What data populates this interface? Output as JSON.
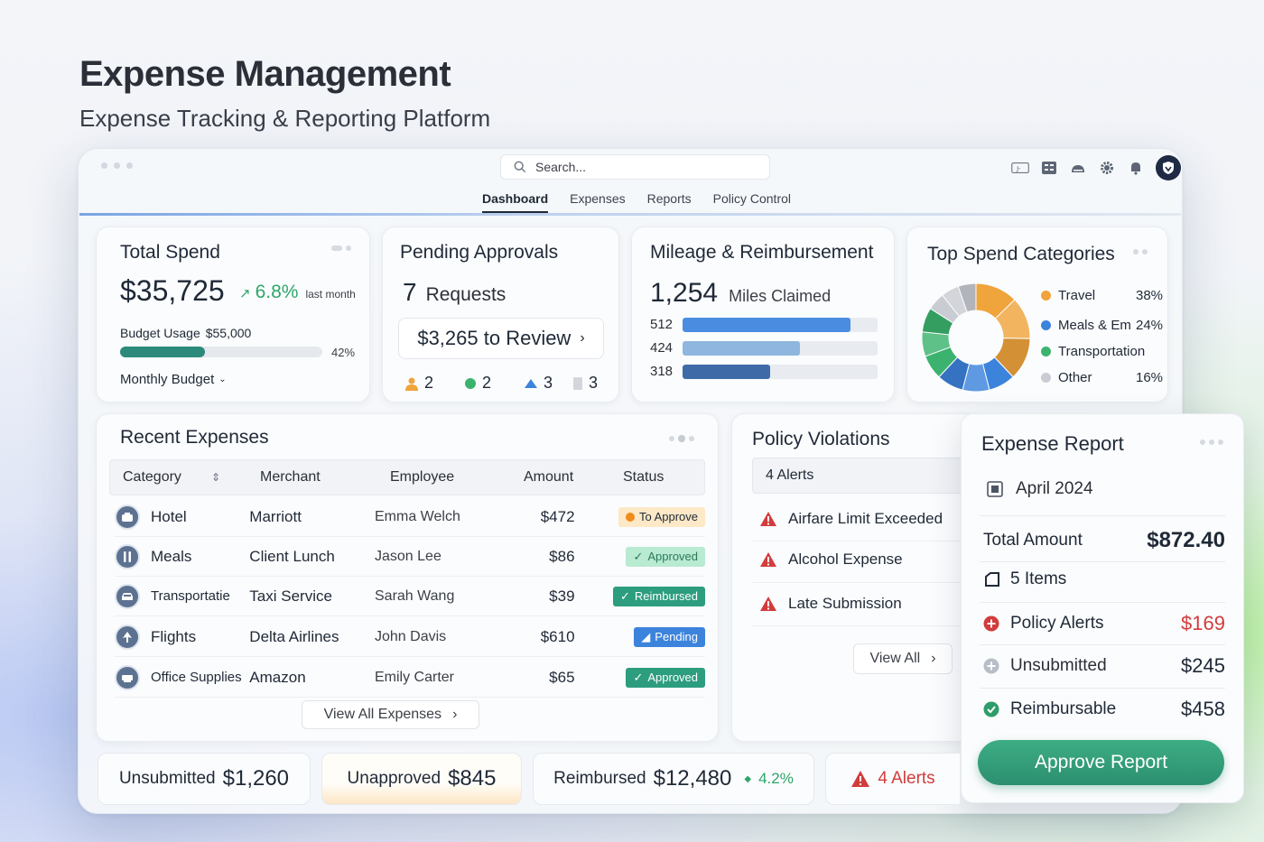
{
  "hero": {
    "title": "Expense Management",
    "subtitle": "Expense Tracking & Reporting Platform"
  },
  "search": {
    "placeholder": "Search..."
  },
  "nav": {
    "tabs": [
      "Dashboard",
      "Expenses",
      "Reports",
      "Policy Control"
    ],
    "active": "Dashboard"
  },
  "toolbar": {
    "icons": [
      "keyboard-icon",
      "grid-icon",
      "cloud-icon",
      "gear-icon",
      "bell-icon",
      "shield-avatar"
    ]
  },
  "total_spend": {
    "title": "Total Spend",
    "amount": "$35,725",
    "change": "6.8%",
    "change_note": "last month",
    "budget_label": "Budget Usage",
    "budget_value": "$55,000",
    "usage_percent_label": "42%",
    "usage_fraction": 0.42,
    "dropdown": "Monthly Budget"
  },
  "pending": {
    "title": "Pending Approvals",
    "count": "7",
    "count_label": "Requests",
    "review_button": "$3,265 to Review",
    "counters": [
      {
        "icon": "person-icon",
        "value": "2",
        "color": "#f0a43c"
      },
      {
        "icon": "circle-icon",
        "value": "2",
        "color": "#3bb36e"
      },
      {
        "icon": "triangle-icon",
        "value": "3",
        "color": "#3c83dc"
      },
      {
        "icon": "document-icon",
        "value": "3",
        "color": "#c9cdd3"
      }
    ]
  },
  "mileage": {
    "title": "Mileage & Reimbursement",
    "value": "1,254",
    "value_label": "Miles Claimed",
    "bars": [
      {
        "label": "512",
        "fraction": 0.86,
        "color": "#4a8de0"
      },
      {
        "label": "424",
        "fraction": 0.6,
        "color": "#8fb6de"
      },
      {
        "label": "318",
        "fraction": 0.45,
        "color": "#3f6aa8"
      }
    ]
  },
  "categories": {
    "title": "Top Spend Categories",
    "chart_data": {
      "type": "pie",
      "slices": [
        {
          "name": "Travel",
          "percent_label": "38%",
          "value": 38,
          "color": "#f0a43c"
        },
        {
          "name": "Meals & Em",
          "percent_label": "24%",
          "value": 24,
          "color": "#3c83dc"
        },
        {
          "name": "Transportation",
          "percent_label": "",
          "value": 22,
          "color": "#3bb36e"
        },
        {
          "name": "Other",
          "percent_label": "16%",
          "value": 16,
          "color": "#c9ccd3"
        }
      ]
    }
  },
  "recent": {
    "title": "Recent Expenses",
    "columns": [
      "Category",
      "Merchant",
      "Employee",
      "Amount",
      "Status"
    ],
    "rows": [
      {
        "category": "Hotel",
        "icon": "hotel-icon",
        "merchant": "Marriott",
        "employee": "Emma Welch",
        "amount": "$472",
        "status": "To Approve",
        "status_style": "orange"
      },
      {
        "category": "Meals",
        "icon": "utensils-icon",
        "merchant": "Client Lunch",
        "employee": "Jason Lee",
        "amount": "$86",
        "status": "Approved",
        "status_style": "lgreen"
      },
      {
        "category": "Transportatie",
        "icon": "car-icon",
        "merchant": "Taxi Service",
        "employee": "Sarah Wang",
        "amount": "$39",
        "status": "Reimbursed",
        "status_style": "teal"
      },
      {
        "category": "Flights",
        "icon": "plane-icon",
        "merchant": "Delta Airlines",
        "employee": "John Davis",
        "amount": "$610",
        "status": "Pending",
        "status_style": "blue"
      },
      {
        "category": "Office Supplies",
        "icon": "printer-icon",
        "merchant": "Amazon",
        "employee": "Emily Carter",
        "amount": "$65",
        "status": "Approved",
        "status_style": "teal"
      }
    ],
    "view_all": "View All Expenses"
  },
  "violations": {
    "title": "Policy Violations",
    "alerts": "4 Alerts",
    "items": [
      "Airfare Limit Exceeded",
      "Alcohol Expense",
      "Late Submission"
    ],
    "view_all": "View All"
  },
  "report": {
    "title": "Expense Report",
    "period": "April 2024",
    "total_label": "Total Amount",
    "total_value": "$872.40",
    "items_label": "5 Items",
    "policy_label": "Policy Alerts",
    "policy_value": "$169",
    "unsub_label": "Unsubmitted",
    "unsub_value": "$245",
    "reimb_label": "Reimbursable",
    "reimb_value": "$458",
    "approve_button": "Approve Report"
  },
  "stats": {
    "unsubmitted_label": "Unsubmitted",
    "unsubmitted_value": "$1,260",
    "unapproved_label": "Unapproved",
    "unapproved_value": "$845",
    "reimbursed_label": "Reimbursed",
    "reimbursed_value": "$12,480",
    "reimbursed_change": "4.2%",
    "alerts_label": "4 Alerts"
  }
}
